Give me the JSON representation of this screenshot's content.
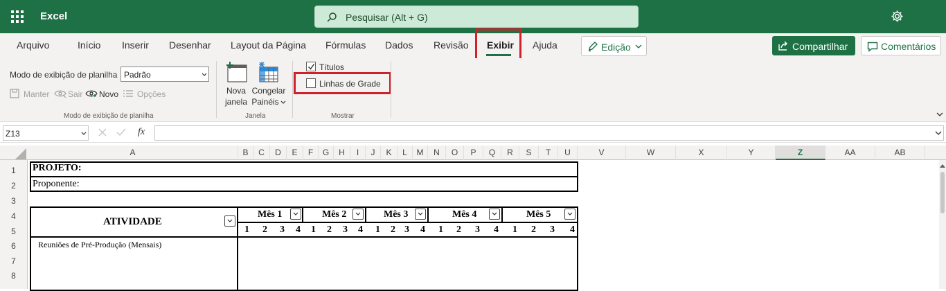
{
  "app": {
    "name": "Excel"
  },
  "search": {
    "placeholder": "Pesquisar (Alt + G)"
  },
  "menu": {
    "tabs": [
      "Arquivo",
      "Início",
      "Inserir",
      "Desenhar",
      "Layout da Página",
      "Fórmulas",
      "Dados",
      "Revisão",
      "Exibir",
      "Ajuda"
    ],
    "active_tab": "Exibir",
    "edit_mode": "Edição",
    "share": "Compartilhar",
    "comments": "Comentários"
  },
  "ribbon": {
    "sheet_view": {
      "label": "Modo de exibição de planilha",
      "value": "Padrão",
      "keep": "Manter",
      "exit": "Sair",
      "new": "Novo",
      "options": "Opções",
      "group": "Modo de exibição de planilha"
    },
    "window": {
      "new_window_1": "Nova",
      "new_window_2": "janela",
      "freeze_1": "Congelar",
      "freeze_2": "Painéis",
      "group": "Janela"
    },
    "show": {
      "headings": "Títulos",
      "headings_checked": true,
      "gridlines": "Linhas de Grade",
      "gridlines_checked": false,
      "group": "Mostrar"
    }
  },
  "formula_bar": {
    "cell_ref": "Z13",
    "fx": "fx",
    "value": ""
  },
  "columns": [
    "A",
    "B",
    "C",
    "D",
    "E",
    "F",
    "G",
    "H",
    "I",
    "J",
    "K",
    "L",
    "M",
    "N",
    "O",
    "P",
    "Q",
    "R",
    "S",
    "T",
    "U",
    "V",
    "W",
    "X",
    "Y",
    "Z",
    "AA",
    "AB"
  ],
  "selected_column": "Z",
  "rows": [
    "1",
    "2",
    "3",
    "4",
    "5",
    "6",
    "7",
    "8"
  ],
  "sheet": {
    "projeto": "PROJETO:",
    "proponente": "Proponente:",
    "atividade": "ATIVIDADE",
    "months": [
      "Mês 1",
      "Mês 2",
      "Mês 3",
      "Mês 4",
      "Mês 5"
    ],
    "weeks": [
      "1",
      "2",
      "3",
      "4"
    ],
    "activity_1": "Reuniões de Pré-Produção (Mensais)"
  },
  "colors": {
    "brand": "#1e7145",
    "highlight": "#d0202a"
  }
}
